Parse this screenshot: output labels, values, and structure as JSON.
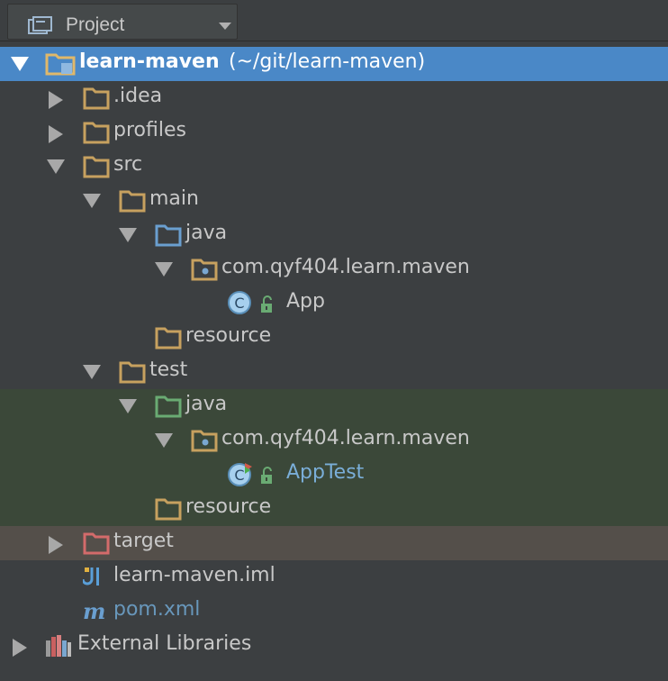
{
  "panel": {
    "title": "Project"
  },
  "tree": {
    "root_name": "learn-maven",
    "root_path": "(~/git/learn-maven)",
    "items": {
      "idea": ".idea",
      "profiles": "profiles",
      "src": "src",
      "main": "main",
      "main_java": "java",
      "main_package": "com.qyf404.learn.maven",
      "app_class": "App",
      "main_resource": "resource",
      "test": "test",
      "test_java": "java",
      "test_package": "com.qyf404.learn.maven",
      "apptest_class": "AppTest",
      "test_resource": "resource",
      "target": "target",
      "iml": "learn-maven.iml",
      "pom": "pom.xml",
      "external": "External Libraries"
    }
  },
  "colors": {
    "selection": "#4a88c7",
    "test_row": "#3b4839",
    "excluded_row": "#544f4a",
    "folder": "#c7a15f",
    "source_folder": "#6a9fd0",
    "test_folder": "#6aab73",
    "excluded_folder": "#d36b6b"
  }
}
